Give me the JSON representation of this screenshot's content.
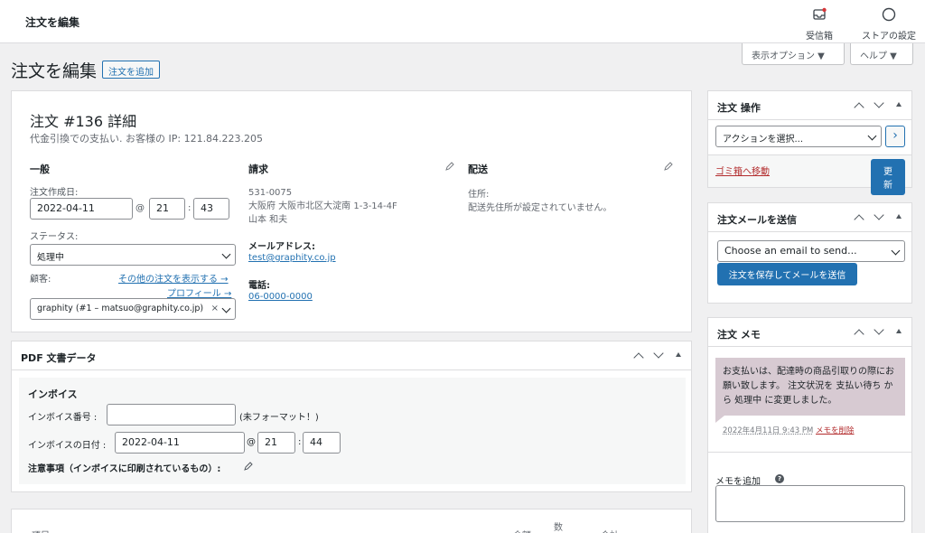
{
  "topbar": {
    "title": "注文を編集",
    "inbox_label": "受信箱",
    "store_settings_label": "ストアの設定"
  },
  "screen_options": {
    "display_label": "表示オプション ▼",
    "help_label": "ヘルプ ▼"
  },
  "page": {
    "title": "注文を編集",
    "add_order_label": "注文を追加"
  },
  "order": {
    "heading": "注文 #136 詳細",
    "meta": "代金引換での支払い. お客様の IP: 121.84.223.205",
    "general": {
      "heading": "一般",
      "created_label": "注文作成日:",
      "date": "2022-04-11",
      "at": "@",
      "hour": "21",
      "colon": ":",
      "minute": "43",
      "status_label": "ステータス:",
      "status_value": "処理中",
      "customer_label": "顧客:",
      "other_orders_link": "その他の注文を表示する →",
      "profile_link": "プロフィール →",
      "customer_value": "graphity (#1 – matsuo@graphity.co.jp)",
      "clear": "×"
    },
    "billing": {
      "heading": "請求",
      "postcode": "531-0075",
      "address": "大阪府 大阪市北区大淀南 1-3-14-4F",
      "name": "山本 和夫",
      "email_label": "メールアドレス:",
      "email": "test@graphity.co.jp",
      "phone_label": "電話:",
      "phone": "06-0000-0000"
    },
    "shipping": {
      "heading": "配送",
      "address_label": "住所:",
      "address_value": "配送先住所が設定されていません。"
    }
  },
  "pdf": {
    "title": "PDF 文書データ",
    "invoice_heading": "インボイス",
    "number_label": "インボイス番号 :",
    "number_value": "",
    "unformatted": "(未フォーマット！)",
    "date_label": "インボイスの日付 :",
    "date_value": "2022-04-11",
    "at": "@",
    "hour": "21",
    "colon": ":",
    "minute": "44",
    "notes_label": "注意事項（インボイスに印刷されているもの）:"
  },
  "items_table": {
    "col_item": "項目",
    "col_price": "金額",
    "col_qty": "数",
    "col_total": "合計"
  },
  "actions": {
    "title": "注文 操作",
    "select_value": "アクションを選択...",
    "go": "›",
    "trash_link": "ゴミ箱へ移動",
    "update_label": "更新"
  },
  "send_email": {
    "title": "注文メールを送信",
    "select_value": "Choose an email to send...",
    "button_label": "注文を保存してメールを送信"
  },
  "notes": {
    "title": "注文 メモ",
    "note_text": "お支払いは、配達時の商品引取りの際にお願い致します。 注文状況を 支払い待ち から 処理中 に変更しました。",
    "note_date": "2022年4月11日 9:43 PM",
    "delete_link": "メモを削除",
    "add_label": "メモを追加",
    "help": "?"
  }
}
